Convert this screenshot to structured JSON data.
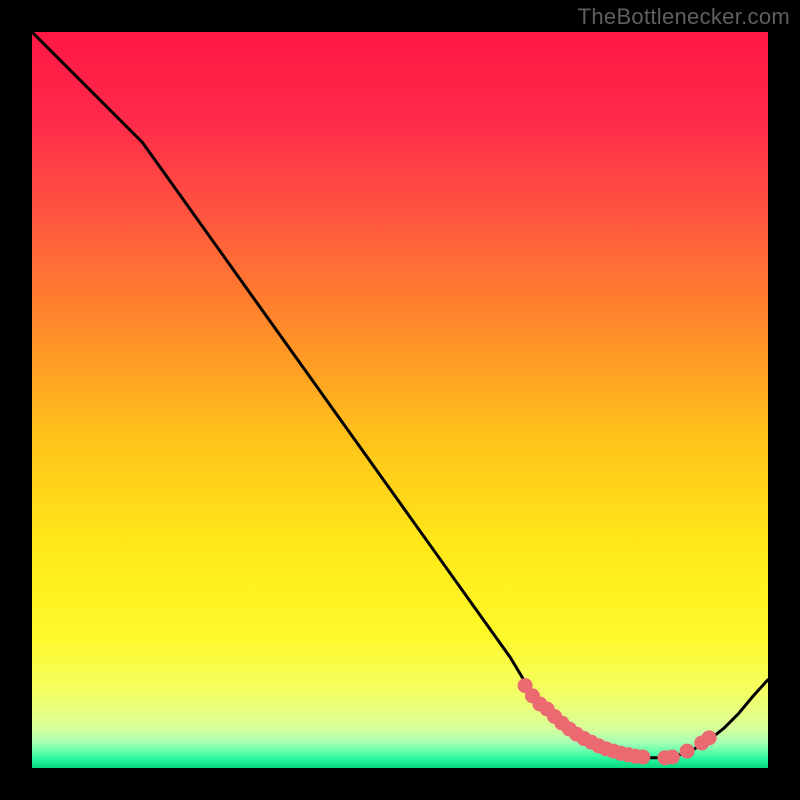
{
  "watermark": "TheBottlenecker.com",
  "chart_data": {
    "type": "line",
    "title": "",
    "xlabel": "",
    "ylabel": "",
    "xlim": [
      0,
      100
    ],
    "ylim": [
      0,
      100
    ],
    "grid": false,
    "series": [
      {
        "name": "curve",
        "color": "#000000",
        "x": [
          0,
          3,
          6,
          9,
          12,
          15,
          20,
          25,
          30,
          35,
          40,
          45,
          50,
          55,
          60,
          65,
          68,
          70,
          72,
          74,
          76,
          78,
          80,
          82,
          84,
          86,
          88,
          90,
          92,
          94,
          96,
          98,
          100
        ],
        "values": [
          100,
          97,
          94,
          91,
          88,
          85,
          78,
          71,
          64,
          57,
          50,
          43,
          36,
          29,
          22,
          15,
          10,
          8,
          6,
          4.5,
          3.4,
          2.6,
          2.0,
          1.6,
          1.4,
          1.4,
          1.8,
          2.6,
          3.8,
          5.4,
          7.4,
          9.8,
          12
        ]
      }
    ],
    "highlight": {
      "type": "scatter",
      "color": "#eb6a71",
      "radius": 7.5,
      "x": [
        67,
        68,
        69,
        70,
        71,
        72,
        73,
        74,
        75,
        76,
        77,
        78,
        79,
        80,
        81,
        82,
        83,
        86,
        87,
        89,
        91,
        92
      ],
      "values": [
        11.2,
        9.8,
        8.7,
        8.0,
        7.0,
        6.1,
        5.3,
        4.6,
        4.0,
        3.5,
        3.0,
        2.6,
        2.3,
        2.0,
        1.8,
        1.6,
        1.5,
        1.4,
        1.5,
        2.3,
        3.4,
        4.1
      ]
    },
    "gradient_stops": [
      {
        "offset": 0.0,
        "color": "#ff1744"
      },
      {
        "offset": 0.12,
        "color": "#ff2a4a"
      },
      {
        "offset": 0.25,
        "color": "#ff5640"
      },
      {
        "offset": 0.4,
        "color": "#ff8a2a"
      },
      {
        "offset": 0.55,
        "color": "#ffc21a"
      },
      {
        "offset": 0.7,
        "color": "#ffe919"
      },
      {
        "offset": 0.82,
        "color": "#fff92a"
      },
      {
        "offset": 0.9,
        "color": "#f3ff66"
      },
      {
        "offset": 0.945,
        "color": "#d9ff9a"
      },
      {
        "offset": 0.965,
        "color": "#a8ffb4"
      },
      {
        "offset": 0.978,
        "color": "#5fffac"
      },
      {
        "offset": 0.988,
        "color": "#25f59a"
      },
      {
        "offset": 1.0,
        "color": "#07d67f"
      }
    ]
  }
}
